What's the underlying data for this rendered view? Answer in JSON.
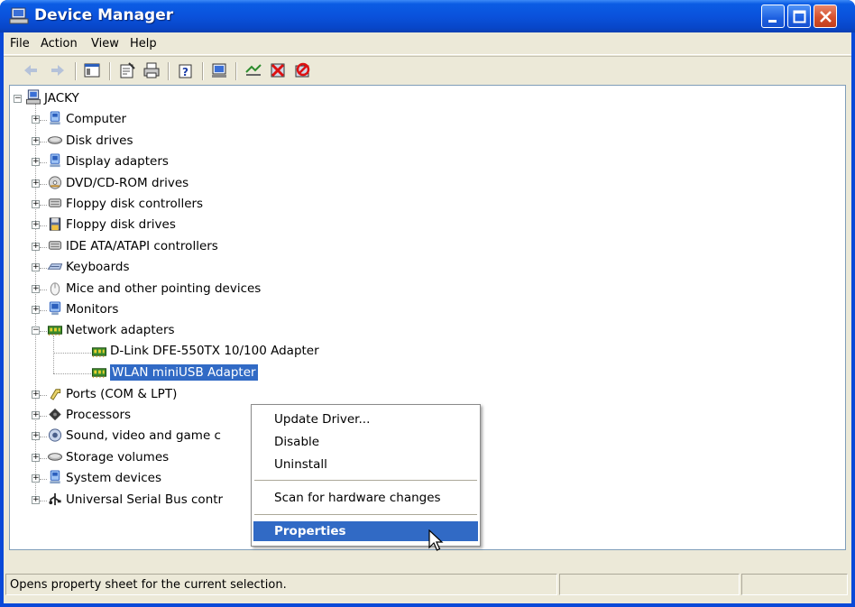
{
  "window": {
    "title": "Device Manager",
    "icon": "device-manager-icon"
  },
  "title_buttons": [
    "minimize-icon",
    "maximize-icon",
    "close-icon"
  ],
  "menu": {
    "items": [
      "File",
      "Action",
      "View",
      "Help"
    ]
  },
  "toolbar": {
    "buttons": [
      "back-arrow-icon",
      "forward-arrow-icon",
      "console-tree-icon",
      "properties-icon",
      "print-icon",
      "help-icon",
      "scan-hardware-icon",
      "update-driver-icon",
      "uninstall-icon",
      "disable-icon"
    ]
  },
  "tree": {
    "root": "JACKY",
    "categories": [
      {
        "label": "Computer",
        "icon": "computer-icon",
        "state": "collapsed"
      },
      {
        "label": "Disk drives",
        "icon": "disk-drive-icon",
        "state": "collapsed"
      },
      {
        "label": "Display adapters",
        "icon": "display-adapter-icon",
        "state": "collapsed"
      },
      {
        "label": "DVD/CD-ROM drives",
        "icon": "cdrom-icon",
        "state": "collapsed"
      },
      {
        "label": "Floppy disk controllers",
        "icon": "controller-icon",
        "state": "collapsed"
      },
      {
        "label": "Floppy disk drives",
        "icon": "floppy-icon",
        "state": "collapsed"
      },
      {
        "label": "IDE ATA/ATAPI controllers",
        "icon": "controller-icon",
        "state": "collapsed"
      },
      {
        "label": "Keyboards",
        "icon": "keyboard-icon",
        "state": "collapsed"
      },
      {
        "label": "Mice and other pointing devices",
        "icon": "mouse-icon",
        "state": "collapsed"
      },
      {
        "label": "Monitors",
        "icon": "monitor-icon",
        "state": "collapsed"
      },
      {
        "label": "Network adapters",
        "icon": "network-card-icon",
        "state": "expanded",
        "children": [
          {
            "label": "D-Link DFE-550TX 10/100 Adapter",
            "icon": "network-card-icon"
          },
          {
            "label": "WLAN miniUSB Adapter",
            "icon": "network-card-icon",
            "selected": true
          }
        ]
      },
      {
        "label": "Ports (COM & LPT)",
        "icon": "port-icon",
        "state": "collapsed"
      },
      {
        "label": "Processors",
        "icon": "processor-icon",
        "state": "collapsed"
      },
      {
        "label": "Sound, video and game c",
        "icon": "sound-icon",
        "state": "collapsed"
      },
      {
        "label": "Storage volumes",
        "icon": "disk-drive-icon",
        "state": "collapsed"
      },
      {
        "label": "System devices",
        "icon": "computer-icon",
        "state": "collapsed"
      },
      {
        "label": "Universal Serial Bus contr",
        "icon": "usb-icon",
        "state": "collapsed"
      }
    ]
  },
  "context_menu": {
    "items": [
      "Update Driver...",
      "Disable",
      "Uninstall",
      "Scan for hardware changes",
      "Properties"
    ],
    "highlighted": "Properties"
  },
  "status": {
    "text": "Opens property sheet for the current selection."
  },
  "colors": {
    "titlebar": "#0a52dc",
    "selection": "#316ac5",
    "face": "#ece9d8"
  }
}
